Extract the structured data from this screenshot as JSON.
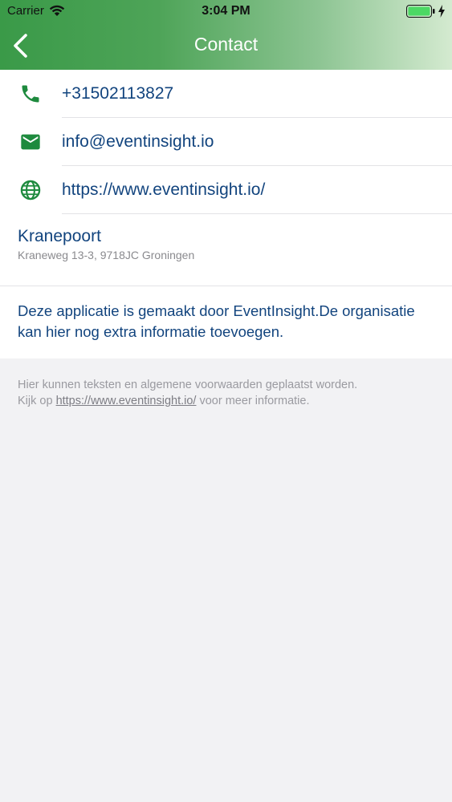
{
  "status_bar": {
    "carrier": "Carrier",
    "time": "3:04 PM"
  },
  "nav": {
    "title": "Contact",
    "back_icon": "chevron-left-icon"
  },
  "contact": {
    "phone": "+31502113827",
    "email": "info@eventinsight.io",
    "website": "https://www.eventinsight.io/"
  },
  "address": {
    "name": "Kranepoort",
    "line": "Kraneweg 13-3, 9718JC Groningen"
  },
  "info": {
    "text": "Deze applicatie is gemaakt door EventInsight.De organisatie kan hier nog extra informatie toevoegen."
  },
  "footer": {
    "line1": "Hier kunnen teksten en algemene voorwaarden geplaatst worden.",
    "prefix": "Kijk op ",
    "link": "https://www.eventinsight.io/",
    "suffix": " voor meer informatie."
  },
  "colors": {
    "accent_green": "#1e8a3e",
    "text_blue": "#12447e",
    "header_start": "#3a9a48",
    "header_end": "#d4ead0"
  }
}
